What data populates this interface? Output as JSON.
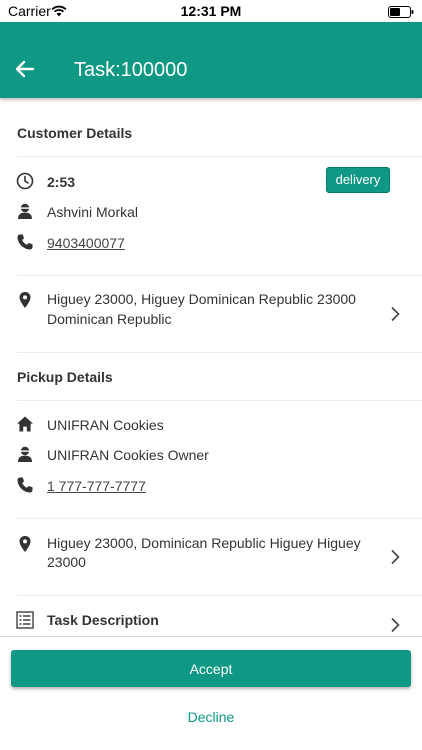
{
  "status_bar": {
    "carrier": "Carrier",
    "time": "12:31 PM"
  },
  "header": {
    "title": "Task:100000",
    "back_icon": "arrow-left-icon"
  },
  "customer": {
    "section_title": "Customer Details",
    "time": "2:53",
    "badge": "delivery",
    "name": "Ashvini Morkal",
    "phone": "9403400077",
    "address_line1": "Higuey 23000, Higuey Dominican Republic 23000",
    "address_line2": "Dominican Republic"
  },
  "pickup": {
    "section_title": "Pickup Details",
    "store": "UNIFRAN Cookies",
    "owner": "UNIFRAN Cookies Owner",
    "phone": "1 777-777-7777",
    "address_line1": "Higuey 23000, Dominican Republic Higuey Higuey",
    "address_line2": "23000"
  },
  "task_description": {
    "label": "Task Description"
  },
  "actions": {
    "accept": "Accept",
    "decline": "Decline"
  },
  "colors": {
    "primary": "#0f9883",
    "text": "#333333",
    "divider": "#ececec"
  }
}
